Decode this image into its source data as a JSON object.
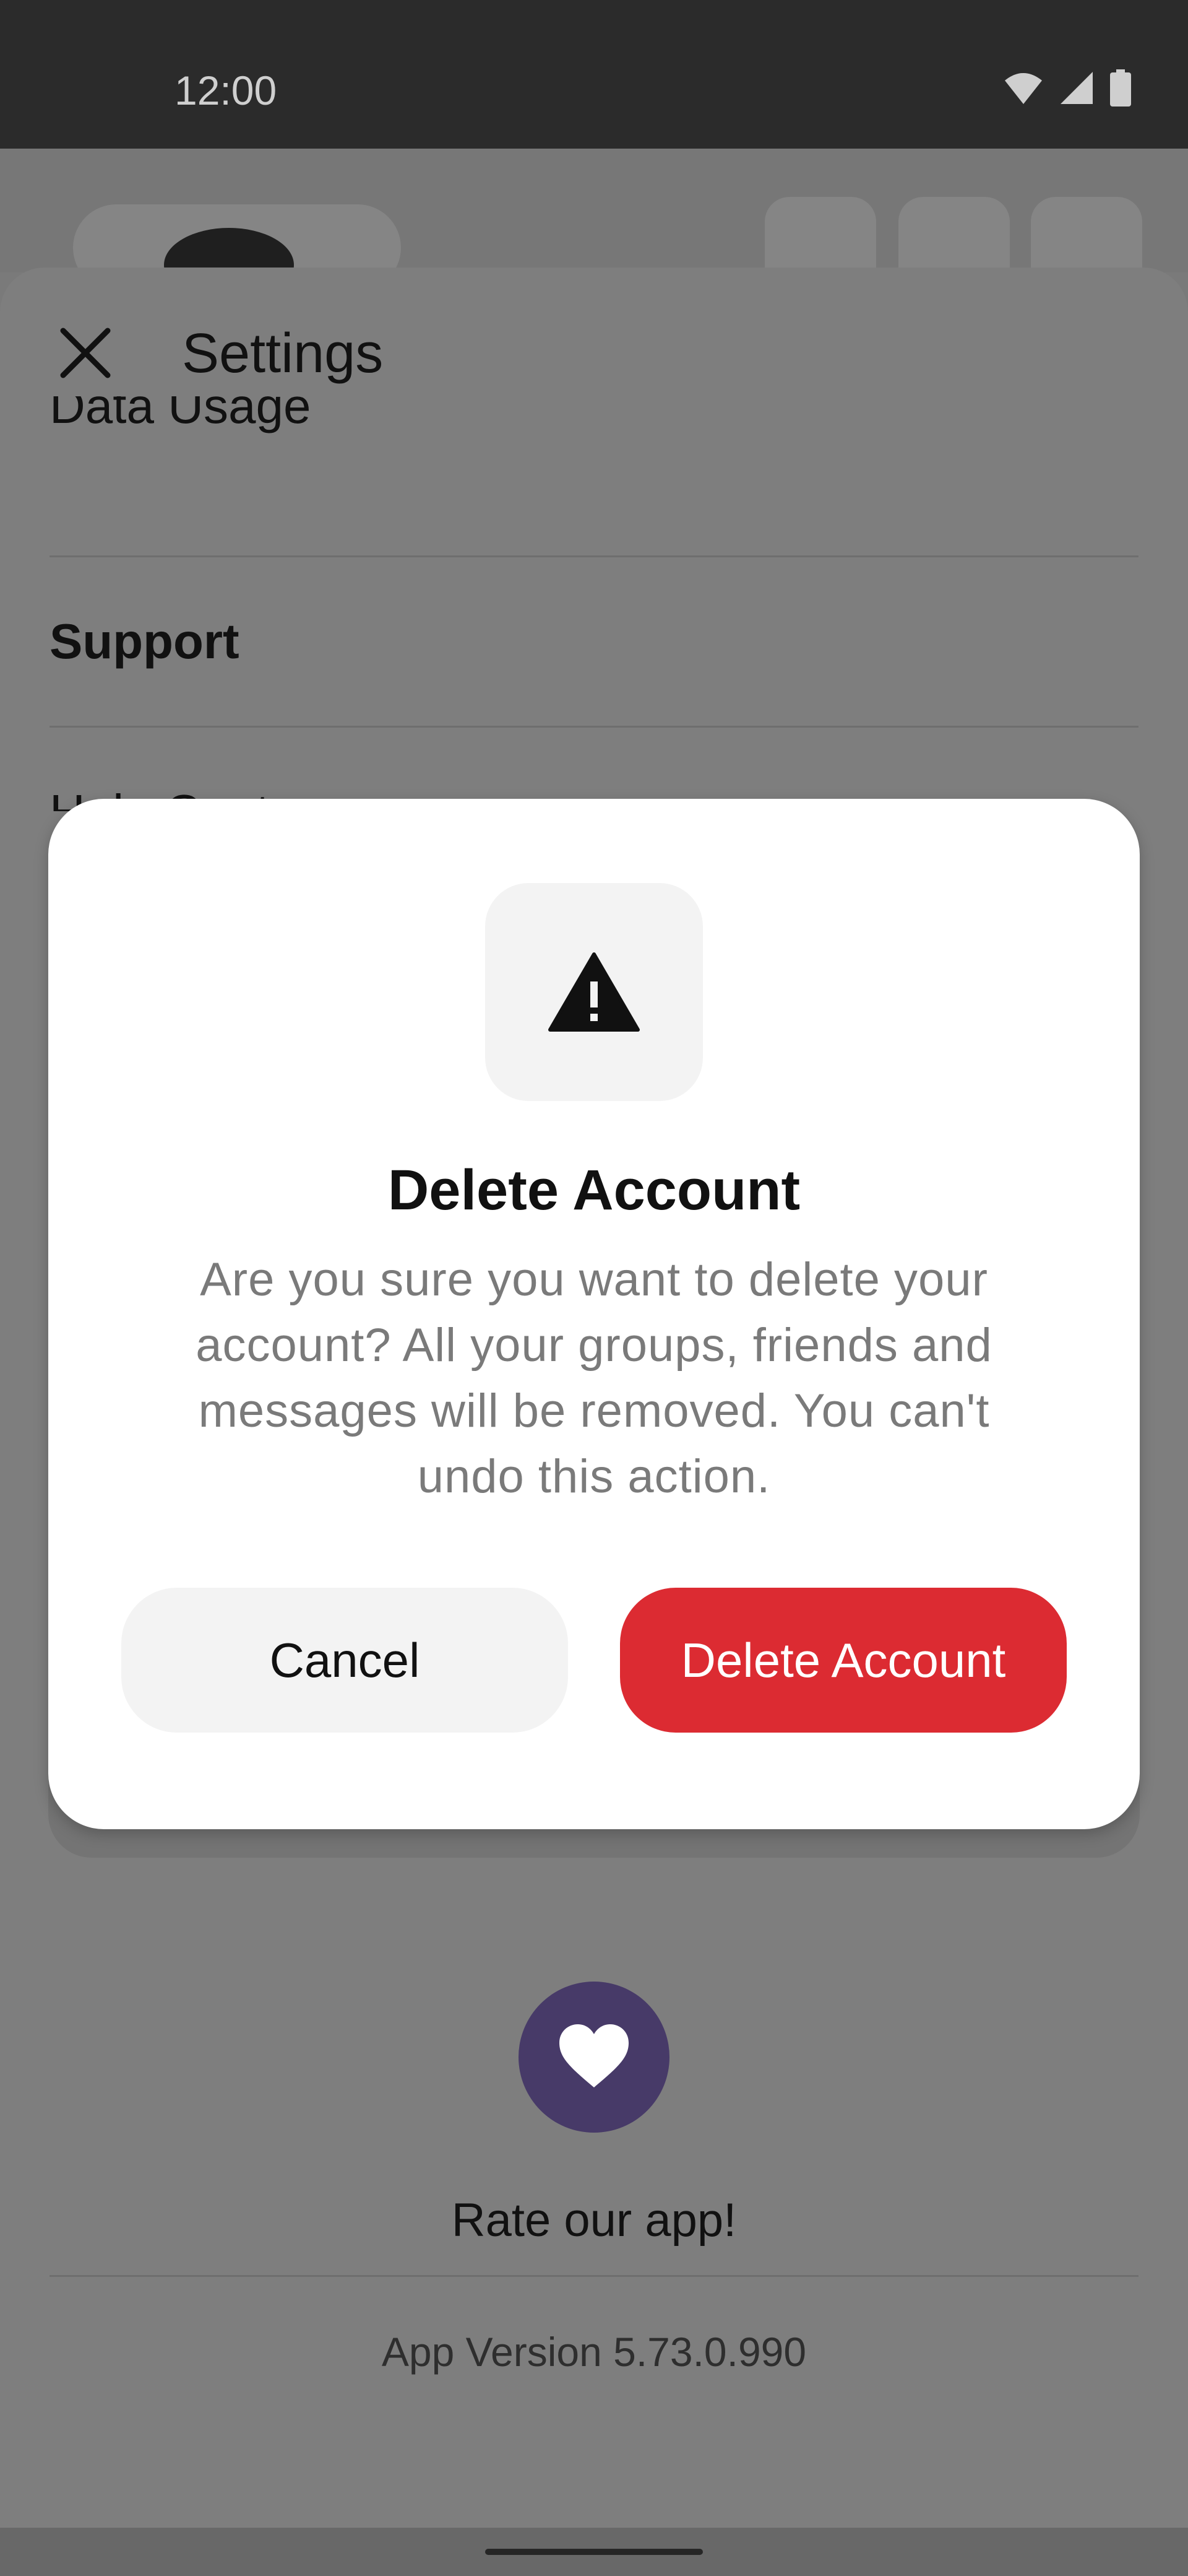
{
  "status_bar": {
    "time": "12:00",
    "icons": [
      "wifi-icon",
      "signal-icon",
      "battery-icon"
    ]
  },
  "header_icons": [
    "edit-icon",
    "gear-icon",
    "share-icon"
  ],
  "sheet": {
    "title": "Settings",
    "close_icon": "close-icon",
    "rows": {
      "data_usage": "Data Usage",
      "support_heading": "Support",
      "help_center": "Help Center"
    }
  },
  "footer": {
    "rate_label": "Rate our app!",
    "version": "App Version 5.73.0.990"
  },
  "dialog": {
    "icon": "warning-icon",
    "title": "Delete Account",
    "message": "Are you sure you want to delete your account? All your groups, friends and messages will be removed. You can't undo this action.",
    "cancel_label": "Cancel",
    "confirm_label": "Delete Account"
  },
  "colors": {
    "danger": "#DC2B32",
    "brand_circle": "#473A68"
  }
}
